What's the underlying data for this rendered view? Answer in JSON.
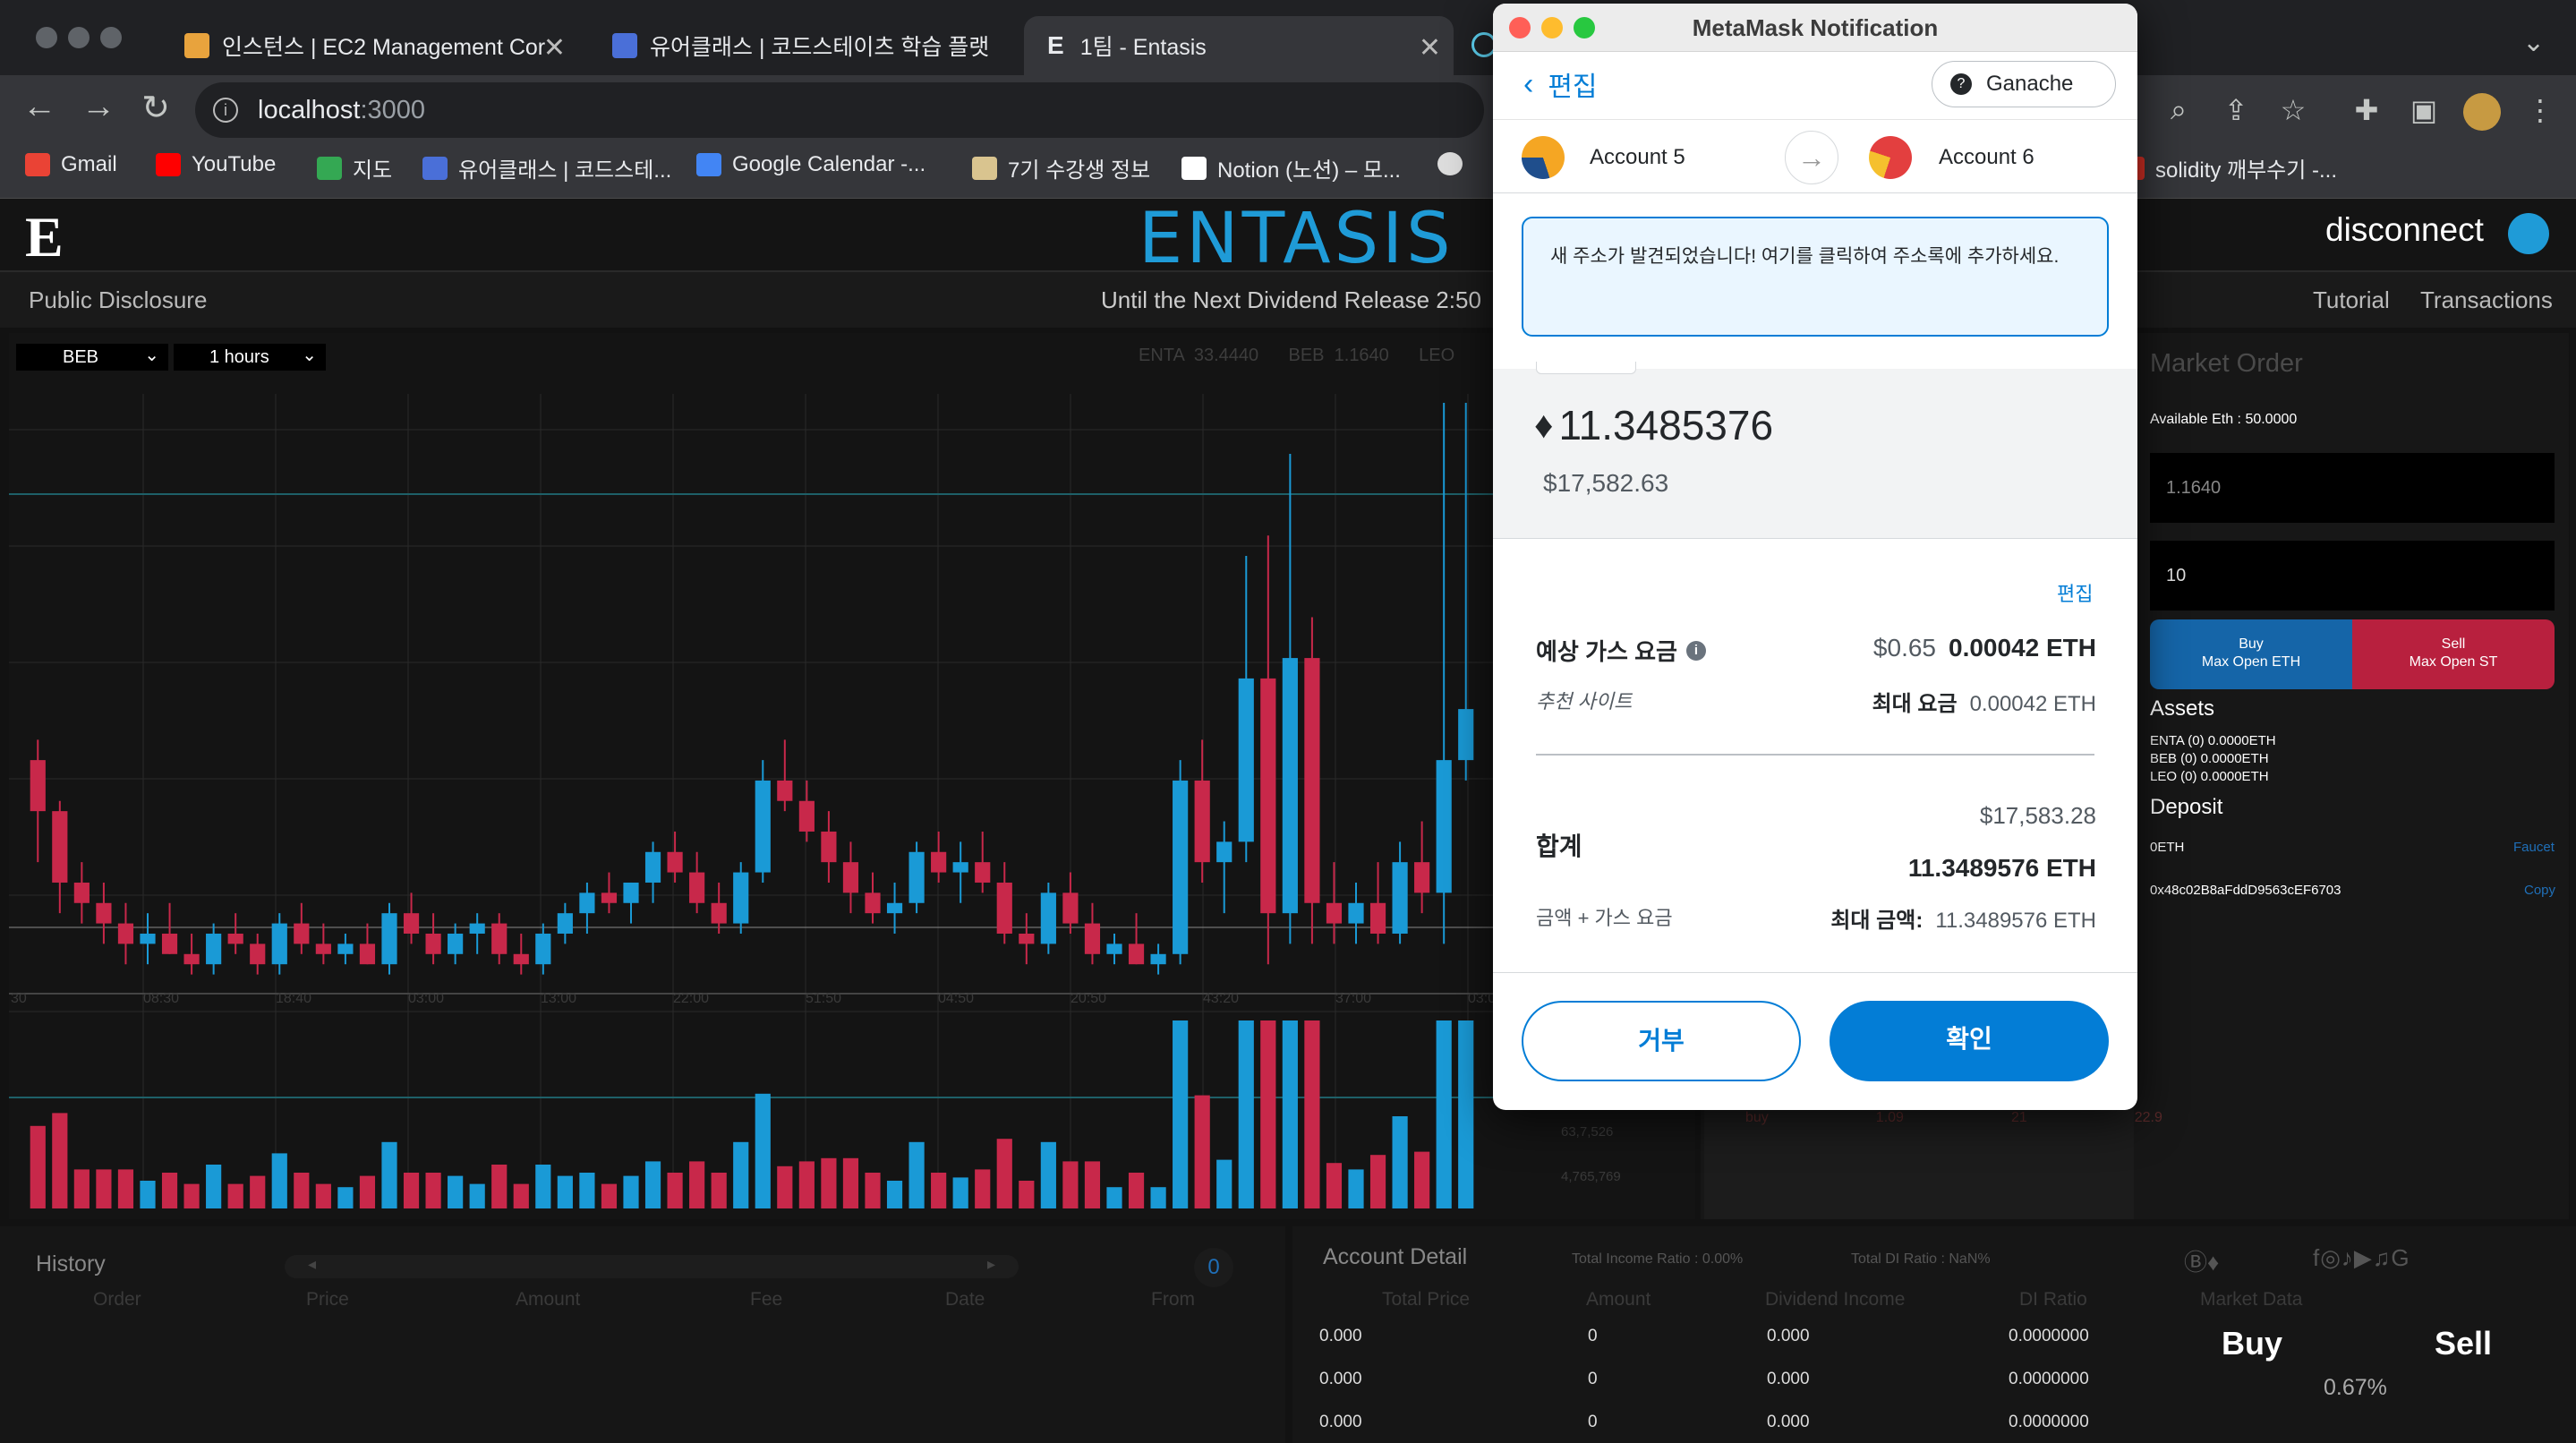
{
  "browser": {
    "tabs": [
      {
        "label": "인스턴스 | EC2 Management Cor"
      },
      {
        "label": "유어클래스 | 코드스테이츠 학습 플랫"
      },
      {
        "label": "1팀 - Entasis"
      }
    ],
    "url_host": "localhost",
    "url_port": ":3000",
    "bookmarks": [
      "Gmail",
      "YouTube",
      "지도",
      "유어클래스 | 코드스테...",
      "Google Calendar -...",
      "7기 수강생 정보",
      "Notion (노션) – 모...",
      "solidity 깨부수기 -..."
    ],
    "colors": {
      "tabstrip": "#202124",
      "toolbar": "#35363a"
    }
  },
  "app": {
    "brand": "ENTASIS",
    "disconnect_label": "disconnect",
    "public_disclosure": "Public Disclosure",
    "countdown": "Until the Next Dividend Release 2:50",
    "tutorial": "Tutorial",
    "transactions": "Transactions",
    "chart": {
      "token_select": "BEB",
      "interval_select": "1 hours",
      "tickers": "ENTA  33.4440      BEB  1.1640      LEO",
      "x_ticks": [
        "30",
        "08:30",
        "18:40",
        "03:00",
        "13:00",
        "22:00",
        "51:50",
        "04:50",
        "20:50",
        "43:20",
        "37:00",
        "03:00"
      ],
      "volume_labels": [
        "63,7,526",
        "4,765,769"
      ]
    },
    "order": {
      "title": "Market Order",
      "available": "Available Eth : 50.0000",
      "price_value": "1.1640",
      "amount_value": "10",
      "buy_label": "Buy",
      "buy_sub": "Max Open ETH",
      "sell_label": "Sell",
      "sell_sub": "Max Open ST",
      "assets_title": "Assets",
      "assets": [
        "ENTA (0) 0.0000ETH",
        "BEB (0) 0.0000ETH",
        "LEO (0) 0.0000ETH"
      ],
      "deposit_title": "Deposit",
      "deposit_balance": "0ETH",
      "faucet": "Faucet",
      "address": "0x48c02B8aFddD9563cEF6703",
      "copy": "Copy",
      "partial_row": [
        "buy",
        "1.09",
        "21",
        "22.9"
      ],
      "colors": {
        "buy": "#1565a8",
        "sell": "#b8203e"
      }
    },
    "history": {
      "title": "History",
      "headers": [
        "Order",
        "Price",
        "Amount",
        "Fee",
        "Date",
        "From"
      ],
      "page": "0"
    },
    "account": {
      "title": "Account Detail",
      "income_ratio": "Total Income Ratio : 0.00%",
      "di_ratio": "Total DI Ratio : NaN%",
      "headers": [
        "Total Price",
        "Amount",
        "Dividend Income",
        "DI Ratio",
        "Market Data"
      ],
      "rows": [
        [
          "0.000",
          "0",
          "0.000",
          "0.0000000"
        ],
        [
          "0.000",
          "0",
          "0.000",
          "0.0000000"
        ],
        [
          "0.000",
          "0",
          "0.000",
          "0.0000000"
        ]
      ],
      "buy": "Buy",
      "sell": "Sell",
      "ratio": "0.67%"
    }
  },
  "metamask": {
    "window_title": "MetaMask Notification",
    "back_label": "편집",
    "network": "Ganache",
    "from_account": "Account 5",
    "to_account": "Account 6",
    "notice": "새 주소가 발견되었습니다! 여기를 클릭하여 주소록에 추가하세요.",
    "amount_eth": "11.3485376",
    "amount_usd": "$17,582.63",
    "edit_link": "편집",
    "gas_label": "예상 가스 요금",
    "gas_usd": "$0.65",
    "gas_eth": "0.00042 ETH",
    "gas_site": "추천 사이트",
    "max_fee_label": "최대 요금",
    "max_fee": "0.00042 ETH",
    "total_label": "합계",
    "total_usd": "$17,583.28",
    "total_eth": "11.3489576 ETH",
    "total_sub": "금액 + 가스 요금",
    "max_amount_label": "최대 금액:",
    "max_amount": "11.3489576 ETH",
    "reject": "거부",
    "confirm": "확인",
    "colors": {
      "primary": "#037dd6"
    }
  },
  "chart_data": {
    "type": "candlestick",
    "x": [
      "30",
      "08:30",
      "18:40",
      "03:00",
      "13:00",
      "22:00",
      "51:50",
      "04:50",
      "20:50",
      "43:20",
      "37:00",
      "03:00"
    ],
    "ohlc_note": "",
    "candles": [
      [
        1.2,
        1.22,
        1.1,
        1.15
      ],
      [
        1.15,
        1.16,
        1.05,
        1.08
      ],
      [
        1.08,
        1.1,
        1.04,
        1.06
      ],
      [
        1.06,
        1.08,
        1.02,
        1.04
      ],
      [
        1.04,
        1.06,
        1.0,
        1.02
      ],
      [
        1.02,
        1.05,
        1.0,
        1.03
      ],
      [
        1.03,
        1.06,
        1.01,
        1.01
      ],
      [
        1.01,
        1.03,
        0.99,
        1.0
      ],
      [
        1.0,
        1.04,
        0.99,
        1.03
      ],
      [
        1.03,
        1.05,
        1.01,
        1.02
      ],
      [
        1.02,
        1.03,
        0.99,
        1.0
      ],
      [
        1.0,
        1.05,
        0.99,
        1.04
      ],
      [
        1.04,
        1.06,
        1.01,
        1.02
      ],
      [
        1.02,
        1.04,
        1.0,
        1.01
      ],
      [
        1.01,
        1.03,
        1.0,
        1.02
      ],
      [
        1.02,
        1.04,
        1.0,
        1.0
      ],
      [
        1.0,
        1.06,
        0.99,
        1.05
      ],
      [
        1.05,
        1.07,
        1.02,
        1.03
      ],
      [
        1.03,
        1.05,
        1.0,
        1.01
      ],
      [
        1.01,
        1.04,
        1.0,
        1.03
      ],
      [
        1.03,
        1.05,
        1.01,
        1.04
      ],
      [
        1.04,
        1.05,
        1.0,
        1.01
      ],
      [
        1.01,
        1.03,
        0.99,
        1.0
      ],
      [
        1.0,
        1.04,
        0.99,
        1.03
      ],
      [
        1.03,
        1.06,
        1.02,
        1.05
      ],
      [
        1.05,
        1.08,
        1.03,
        1.07
      ],
      [
        1.07,
        1.09,
        1.05,
        1.06
      ],
      [
        1.06,
        1.08,
        1.04,
        1.08
      ],
      [
        1.08,
        1.12,
        1.06,
        1.11
      ],
      [
        1.11,
        1.13,
        1.08,
        1.09
      ],
      [
        1.09,
        1.11,
        1.05,
        1.06
      ],
      [
        1.06,
        1.08,
        1.03,
        1.04
      ],
      [
        1.04,
        1.1,
        1.03,
        1.09
      ],
      [
        1.09,
        1.2,
        1.08,
        1.18
      ],
      [
        1.18,
        1.22,
        1.15,
        1.16
      ],
      [
        1.16,
        1.18,
        1.12,
        1.13
      ],
      [
        1.13,
        1.15,
        1.08,
        1.1
      ],
      [
        1.1,
        1.12,
        1.05,
        1.07
      ],
      [
        1.07,
        1.09,
        1.04,
        1.05
      ],
      [
        1.05,
        1.08,
        1.03,
        1.06
      ],
      [
        1.06,
        1.12,
        1.05,
        1.11
      ],
      [
        1.11,
        1.13,
        1.08,
        1.09
      ],
      [
        1.09,
        1.12,
        1.06,
        1.1
      ],
      [
        1.1,
        1.13,
        1.07,
        1.08
      ],
      [
        1.08,
        1.1,
        1.02,
        1.03
      ],
      [
        1.03,
        1.05,
        1.0,
        1.02
      ],
      [
        1.02,
        1.08,
        1.01,
        1.07
      ],
      [
        1.07,
        1.09,
        1.03,
        1.04
      ],
      [
        1.04,
        1.06,
        1.0,
        1.01
      ],
      [
        1.01,
        1.03,
        1.0,
        1.02
      ],
      [
        1.02,
        1.05,
        1.0,
        1.0
      ],
      [
        1.0,
        1.02,
        0.99,
        1.01
      ],
      [
        1.01,
        1.2,
        1.0,
        1.18
      ],
      [
        1.18,
        1.22,
        1.08,
        1.1
      ],
      [
        1.1,
        1.14,
        1.05,
        1.12
      ],
      [
        1.12,
        1.4,
        1.1,
        1.28
      ],
      [
        1.28,
        1.42,
        1.0,
        1.05
      ],
      [
        1.05,
        1.5,
        1.02,
        1.3
      ],
      [
        1.3,
        1.34,
        1.02,
        1.06
      ],
      [
        1.06,
        1.1,
        1.02,
        1.04
      ],
      [
        1.04,
        1.08,
        1.02,
        1.06
      ],
      [
        1.06,
        1.1,
        1.02,
        1.03
      ],
      [
        1.03,
        1.12,
        1.02,
        1.1
      ],
      [
        1.1,
        1.14,
        1.05,
        1.07
      ],
      [
        1.07,
        1.8,
        1.02,
        1.2
      ],
      [
        1.2,
        1.95,
        1.18,
        1.25
      ]
    ]
  }
}
